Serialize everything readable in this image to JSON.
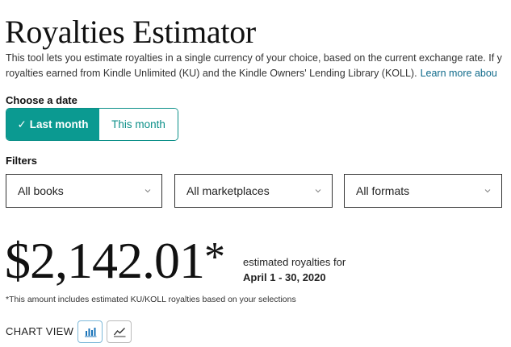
{
  "header": {
    "title": "Royalties Estimator",
    "description_line1": "This tool lets you estimate royalties in a single currency of your choice, based on the current exchange rate. If y",
    "description_line2": "royalties earned from Kindle Unlimited (KU) and the Kindle Owners' Lending Library (KOLL).",
    "learn_more": "Learn more abou"
  },
  "date": {
    "label": "Choose a date",
    "options": [
      "Last month",
      "This month"
    ],
    "selected": "Last month",
    "check_glyph": "✓"
  },
  "filters": {
    "label": "Filters",
    "books": "All books",
    "marketplaces": "All marketplaces",
    "formats": "All formats"
  },
  "summary": {
    "amount": "$2,142.01",
    "asterisk": "*",
    "caption": "estimated royalties for",
    "period": "April 1 - 30, 2020",
    "footnote": "*This amount includes estimated KU/KOLL royalties based on your selections"
  },
  "chart_view": {
    "label": "CHART VIEW",
    "icons": [
      "bar-chart-icon",
      "line-chart-icon"
    ],
    "selected": "bar-chart-icon"
  },
  "colors": {
    "accent": "#0b9a91",
    "link": "#0f6a8a",
    "icon_blue": "#1a73b8"
  }
}
